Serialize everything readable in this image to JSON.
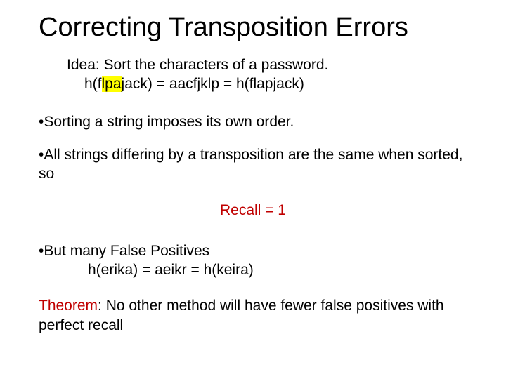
{
  "title": "Correcting Transposition Errors",
  "idea": {
    "line1_prefix": "Idea: Sort the characters of a password.",
    "line2_a": "h(f",
    "line2_hl": "lpa",
    "line2_b": "jack) = aacfjklp = h(flapjack)"
  },
  "bullets": {
    "b1": "Sorting a string imposes its own order.",
    "b2": "All strings differing by a transposition are the same when sorted, so",
    "recall": "Recall = 1",
    "b3": "But many False Positives",
    "b3_sub": "h(erika) = aeikr = h(keira)"
  },
  "theorem": {
    "label": "Theorem",
    "text": ": No other method will have fewer false positives with perfect recall"
  }
}
